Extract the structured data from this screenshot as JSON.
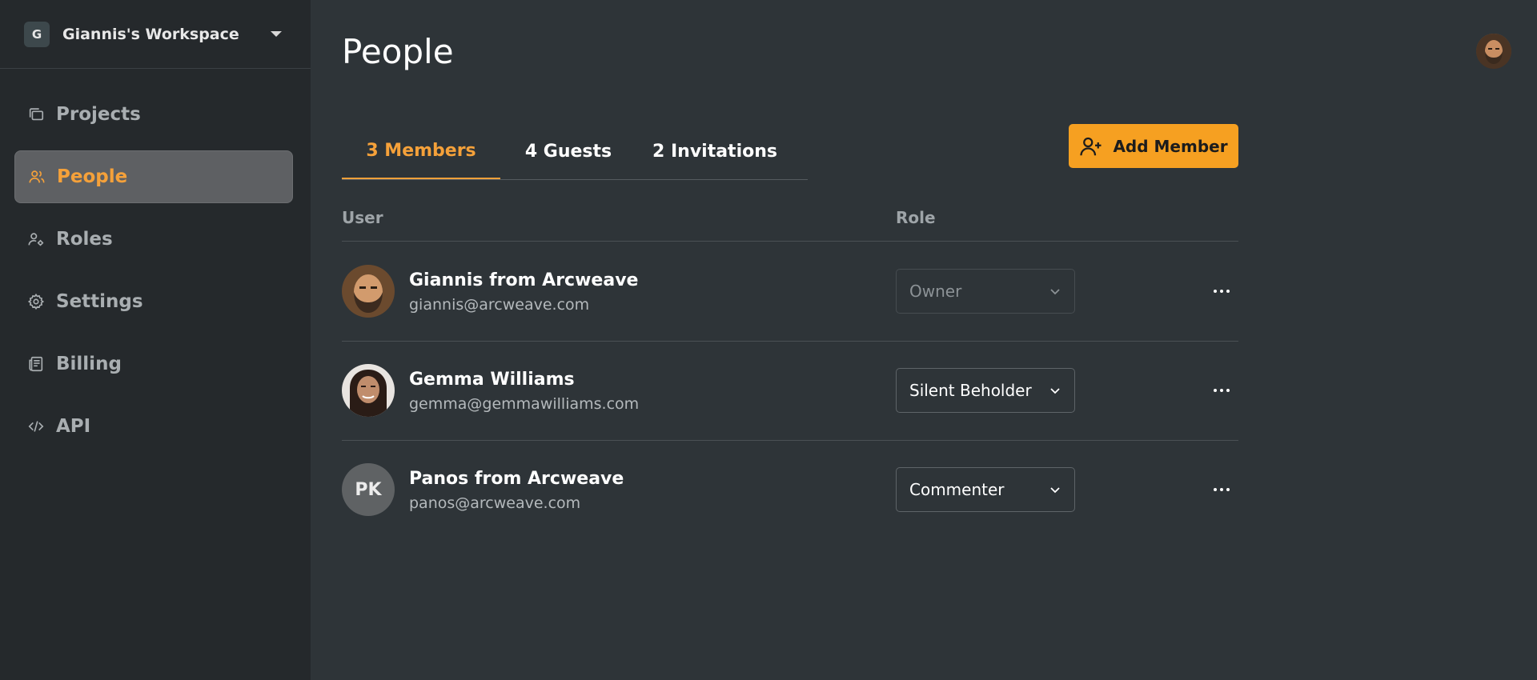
{
  "workspace": {
    "badge": "G",
    "name": "Giannis's Workspace"
  },
  "nav": [
    {
      "label": "Projects",
      "icon": "projects-icon",
      "active": false
    },
    {
      "label": "People",
      "icon": "people-icon",
      "active": true
    },
    {
      "label": "Roles",
      "icon": "roles-icon",
      "active": false
    },
    {
      "label": "Settings",
      "icon": "gear-icon",
      "active": false
    },
    {
      "label": "Billing",
      "icon": "billing-icon",
      "active": false
    },
    {
      "label": "API",
      "icon": "code-icon",
      "active": false
    }
  ],
  "page": {
    "title": "People"
  },
  "tabs": [
    {
      "label": "3 Members",
      "active": true
    },
    {
      "label": "4 Guests",
      "active": false
    },
    {
      "label": "2 Invitations",
      "active": false
    }
  ],
  "actions": {
    "add_member": "Add Member"
  },
  "table": {
    "headers": {
      "user": "User",
      "role": "Role"
    },
    "rows": [
      {
        "name": "Giannis from Arcweave",
        "email": "giannis@arcweave.com",
        "role": "Owner",
        "role_disabled": true,
        "avatar": "photo"
      },
      {
        "name": "Gemma Williams",
        "email": "gemma@gemmawilliams.com",
        "role": "Silent Beholder",
        "role_disabled": false,
        "avatar": "photo"
      },
      {
        "name": "Panos from Arcweave",
        "email": "panos@arcweave.com",
        "role": "Commenter",
        "role_disabled": false,
        "avatar": "initials",
        "initials": "PK"
      }
    ]
  },
  "colors": {
    "accent": "#f6a021",
    "background": "#2e3438",
    "sidebar": "#25292c"
  }
}
